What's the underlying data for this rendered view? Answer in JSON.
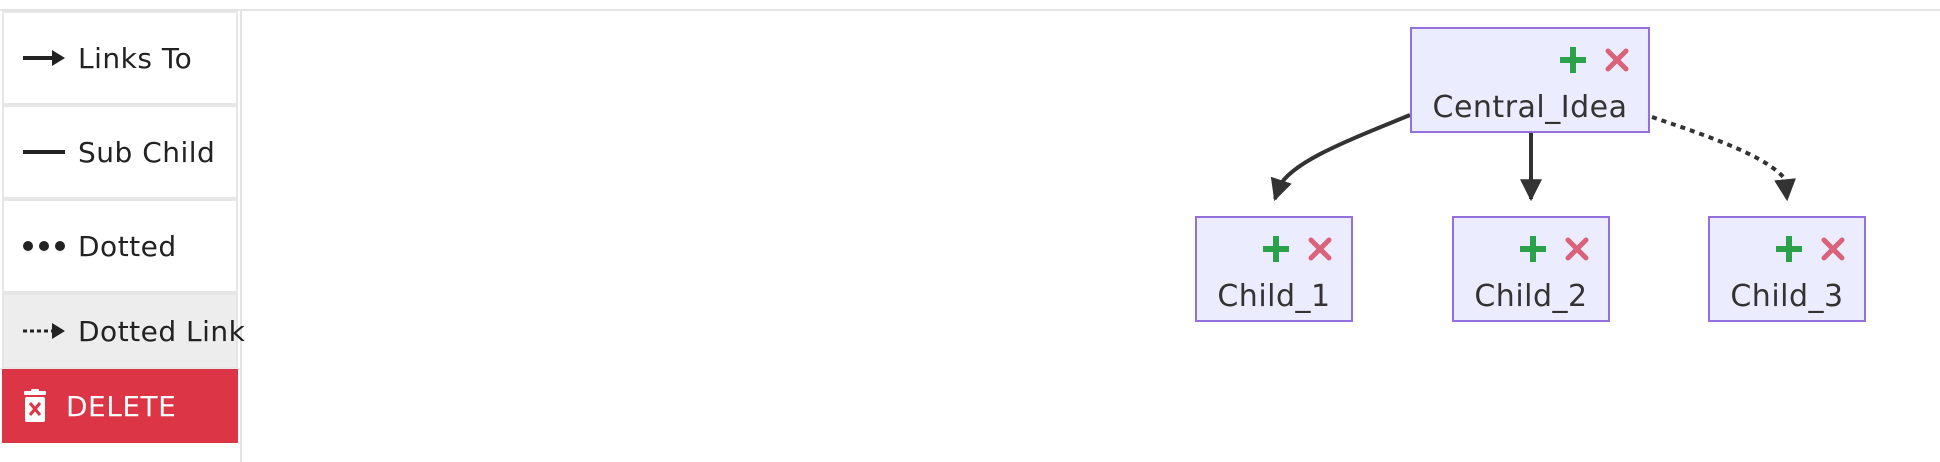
{
  "toolbar": {
    "items": [
      {
        "label": "Links To",
        "icon": "arrow-right-icon"
      },
      {
        "label": "Sub Child",
        "icon": "solid-line-icon"
      },
      {
        "label": "Dotted",
        "icon": "dots-icon"
      },
      {
        "label": "Dotted Link",
        "icon": "dotted-arrow-icon"
      }
    ],
    "delete_label": "DELETE",
    "delete_icon": "trash-icon",
    "delete_color": "#dc3545"
  },
  "diagram": {
    "node_fill": "#ececff",
    "node_border": "#9370db",
    "add_color": "#2aa14a",
    "remove_color": "#d9637a",
    "nodes": {
      "central": "Central_Idea",
      "child1": "Child_1",
      "child2": "Child_2",
      "child3": "Child_3"
    },
    "edges": [
      {
        "from": "Central_Idea",
        "to": "Child_1",
        "style": "solid-arrow"
      },
      {
        "from": "Central_Idea",
        "to": "Child_2",
        "style": "solid-arrow"
      },
      {
        "from": "Central_Idea",
        "to": "Child_3",
        "style": "dotted-arrow"
      }
    ]
  }
}
